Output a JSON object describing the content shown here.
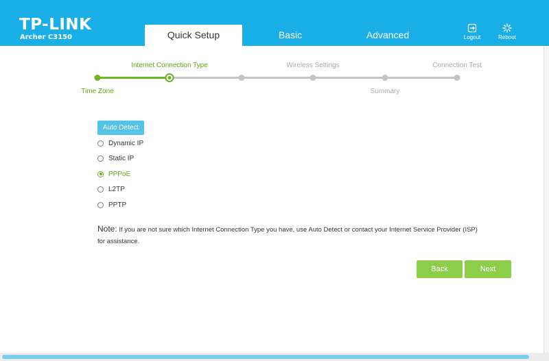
{
  "header": {
    "logo": "TP-LINK",
    "model": "Archer C3150",
    "tabs": [
      {
        "label": "Quick Setup",
        "active": true
      },
      {
        "label": "Basic",
        "active": false
      },
      {
        "label": "Advanced",
        "active": false
      }
    ],
    "actions": [
      {
        "label": "Logout",
        "icon": "logout-icon"
      },
      {
        "label": "Reboot",
        "icon": "reboot-icon"
      }
    ],
    "color": "#1aaee6"
  },
  "progress": {
    "steps": [
      {
        "label": "Time Zone",
        "state": "done"
      },
      {
        "label": "Internet Connection Type",
        "state": "current"
      },
      {
        "label": "Wireless Settings",
        "state": "pending"
      },
      {
        "label": "Summary",
        "state": "pending"
      },
      {
        "label": "Connection Test",
        "state": "pending"
      }
    ],
    "active_color": "#6bb522",
    "pending_color": "#c4c4c4"
  },
  "content": {
    "auto_detect_label": "Auto Detect",
    "connection_types": [
      {
        "label": "Dynamic IP",
        "selected": false
      },
      {
        "label": "Static IP",
        "selected": false
      },
      {
        "label": "PPPoE",
        "selected": true
      },
      {
        "label": "L2TP",
        "selected": false
      },
      {
        "label": "PPTP",
        "selected": false
      }
    ],
    "note_prefix": "Note:",
    "note_text": " If you are not sure which Internet Connection Type you have, use Auto Detect or contact your Internet Service Provider (ISP) for assistance.",
    "back_label": "Back",
    "next_label": "Next",
    "button_color": "#8cce4a"
  }
}
